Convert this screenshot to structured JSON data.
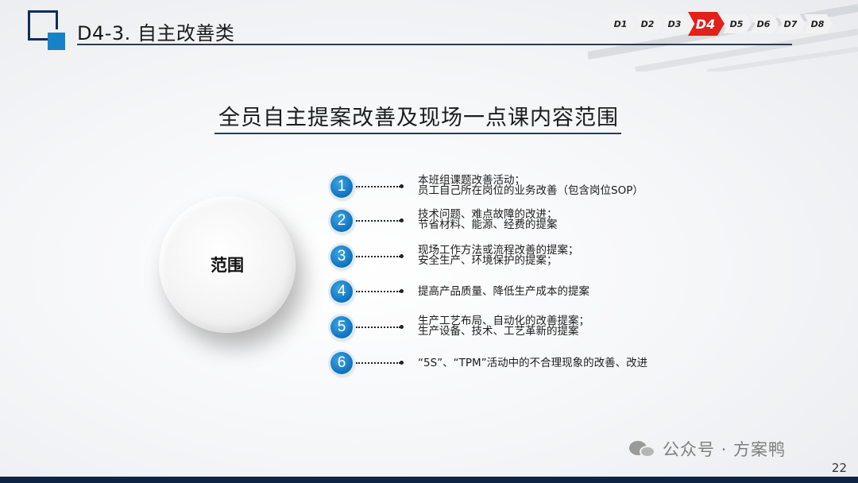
{
  "header": {
    "title": "D4-3. 自主改善类",
    "steps": [
      {
        "label": "D1",
        "active": false
      },
      {
        "label": "D2",
        "active": false
      },
      {
        "label": "D3",
        "active": false
      },
      {
        "label": "D4",
        "active": true
      },
      {
        "label": "D5",
        "active": false
      },
      {
        "label": "D6",
        "active": false
      },
      {
        "label": "D7",
        "active": false
      },
      {
        "label": "D8",
        "active": false
      }
    ]
  },
  "main": {
    "title": "全员自主提案改善及现场一点课内容范围",
    "circle_label": "范围",
    "items": [
      {
        "number": "1",
        "lines": [
          "本班组课题改善活动；",
          "员工自己所在岗位的业务改善（包含岗位SOP）"
        ]
      },
      {
        "number": "2",
        "lines": [
          "技术问题、难点故障的改进；",
          "节省材料、能源、经费的提案"
        ]
      },
      {
        "number": "3",
        "lines": [
          "现场工作方法或流程改善的提案；",
          "安全生产、环境保护的提案；"
        ]
      },
      {
        "number": "4",
        "lines": [
          "提高产品质量、降低生产成本的提案"
        ]
      },
      {
        "number": "5",
        "lines": [
          "生产工艺布局、自动化的改善提案；",
          "生产设备、技术、工艺革新的提案"
        ]
      },
      {
        "number": "6",
        "lines": [
          "“5S”、“TPM”活动中的不合理现象的改善、改进"
        ]
      }
    ]
  },
  "footer": {
    "watermark": "公众号 · 方案鸭",
    "page_number": "22"
  },
  "colors": {
    "accent_blue": "#1479c4",
    "active_step_red": "#e2201c",
    "navy": "#0e2444"
  }
}
